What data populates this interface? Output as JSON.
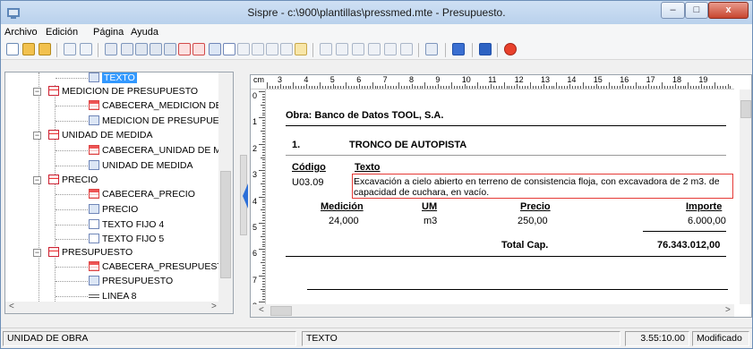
{
  "window": {
    "title": "Sispre - c:\\900\\plantillas\\pressmed.mte - Presupuesto.",
    "min_glyph": "–",
    "max_glyph": "□",
    "close_glyph": "x"
  },
  "menu": {
    "archivo": "Archivo",
    "edicion": "Edición",
    "pagina": "Página",
    "ayuda": "Ayuda"
  },
  "tree": {
    "items": [
      {
        "label": "TEXTO",
        "icon": "field-icon",
        "selected": true
      },
      {
        "label": "MEDICION DE PRESUPUESTO",
        "icon": "section-icon"
      },
      {
        "label": "CABECERA_MEDICION DE P",
        "icon": "table-icon"
      },
      {
        "label": "MEDICION DE PRESUPUESTO",
        "icon": "field-icon"
      },
      {
        "label": "UNIDAD DE MEDIDA",
        "icon": "section-icon"
      },
      {
        "label": "CABECERA_UNIDAD DE MEI",
        "icon": "table-icon"
      },
      {
        "label": "UNIDAD DE MEDIDA",
        "icon": "field-icon"
      },
      {
        "label": "PRECIO",
        "icon": "section-icon"
      },
      {
        "label": "CABECERA_PRECIO",
        "icon": "table-icon"
      },
      {
        "label": "PRECIO",
        "icon": "field-icon"
      },
      {
        "label": "TEXTO FIJO 4",
        "icon": "fixed-text-icon"
      },
      {
        "label": "TEXTO FIJO 5",
        "icon": "fixed-text-icon"
      },
      {
        "label": "PRESUPUESTO",
        "icon": "section-icon"
      },
      {
        "label": "CABECERA_PRESUPUESTO",
        "icon": "table-icon"
      },
      {
        "label": "PRESUPUESTO",
        "icon": "field-icon"
      },
      {
        "label": "LINEA 8",
        "icon": "line-icon"
      }
    ]
  },
  "ruler": {
    "unit": "cm",
    "numbers": [
      "3",
      "4",
      "5",
      "6",
      "7",
      "8",
      "9",
      "10",
      "11",
      "12",
      "13",
      "14",
      "15",
      "16",
      "17",
      "18",
      "19"
    ],
    "vnumbers": [
      "0",
      "1",
      "2",
      "3",
      "4",
      "5",
      "6",
      "7",
      "8"
    ]
  },
  "document": {
    "obra": "Obra: Banco de Datos TOOL, S.A.",
    "chapter_num": "1.",
    "chapter_title": "TRONCO DE AUTOPISTA",
    "col_codigo": "Código",
    "col_texto": "Texto",
    "item_code": "U03.09",
    "item_text_1": "Excavación a cielo abierto en terreno de consistencia floja, con excavadora de 2 m3. de",
    "item_text_2": "capacidad de cuchara, en vacío.",
    "col_medicion": "Medición",
    "col_um": "UM",
    "col_precio": "Precio",
    "col_importe": "Importe",
    "medicion": "24,000",
    "um": "m3",
    "precio": "250,00",
    "importe": "6.000,00",
    "total_label": "Total Cap.",
    "total_value": "76.343.012,00"
  },
  "status": {
    "left": "UNIDAD DE OBRA",
    "middle": "TEXTO",
    "time": "3.55:10.00",
    "state": "Modificado"
  },
  "colors": {
    "selection": "#3399ff",
    "highlight_box": "#e53935",
    "splitter_arrow": "#2c6fd8"
  }
}
